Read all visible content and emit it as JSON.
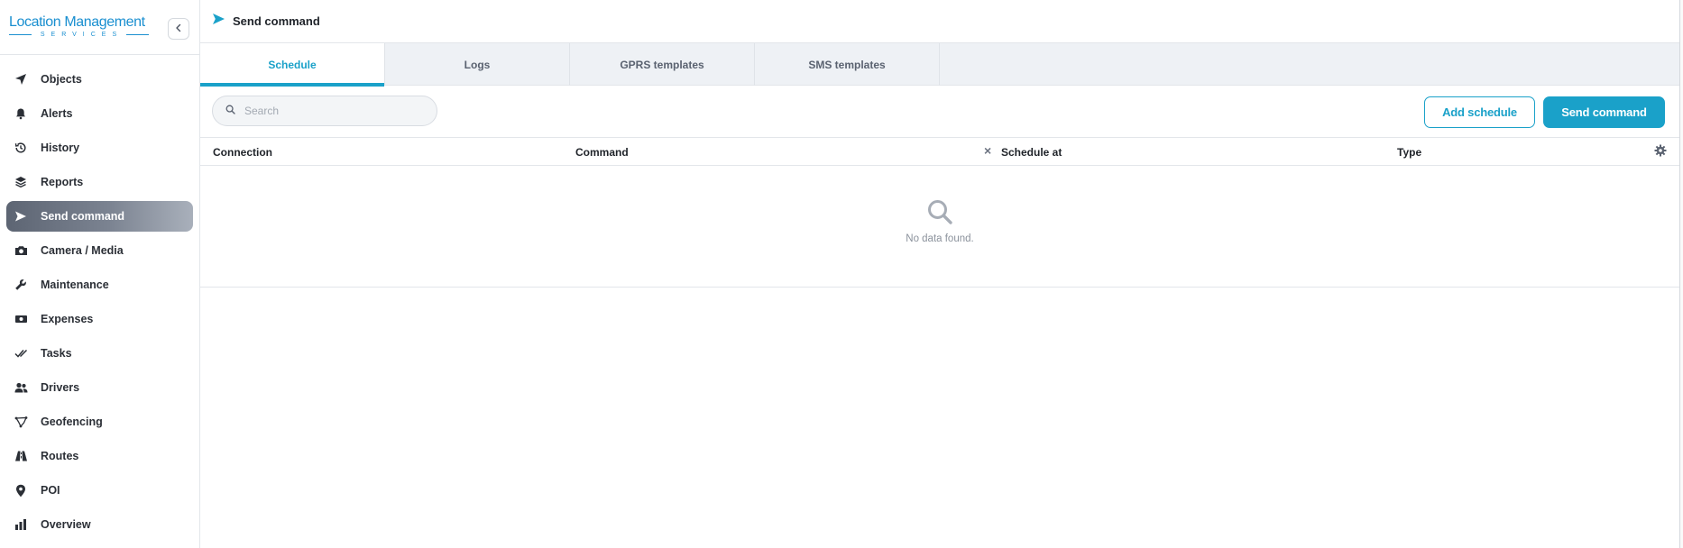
{
  "brand": {
    "title": "Location Management",
    "subtitle": "SERVICES"
  },
  "sidebar": {
    "items": [
      {
        "label": "Objects",
        "icon": "navigation-arrow-icon"
      },
      {
        "label": "Alerts",
        "icon": "bell-icon"
      },
      {
        "label": "History",
        "icon": "history-icon"
      },
      {
        "label": "Reports",
        "icon": "layers-icon"
      },
      {
        "label": "Send command",
        "icon": "send-icon",
        "active": true
      },
      {
        "label": "Camera / Media",
        "icon": "camera-icon"
      },
      {
        "label": "Maintenance",
        "icon": "wrench-icon"
      },
      {
        "label": "Expenses",
        "icon": "money-icon"
      },
      {
        "label": "Tasks",
        "icon": "double-check-icon"
      },
      {
        "label": "Drivers",
        "icon": "users-icon"
      },
      {
        "label": "Geofencing",
        "icon": "polygon-icon"
      },
      {
        "label": "Routes",
        "icon": "road-icon"
      },
      {
        "label": "POI",
        "icon": "map-pin-icon"
      },
      {
        "label": "Overview",
        "icon": "bar-chart-icon"
      }
    ]
  },
  "header": {
    "title": "Send command"
  },
  "tabs": [
    {
      "label": "Schedule",
      "active": true
    },
    {
      "label": "Logs"
    },
    {
      "label": "GPRS templates"
    },
    {
      "label": "SMS templates"
    }
  ],
  "toolbar": {
    "search_placeholder": "Search",
    "add_schedule_label": "Add schedule",
    "send_command_label": "Send command"
  },
  "table": {
    "columns": [
      "Connection",
      "Command",
      "Schedule at",
      "Type"
    ],
    "empty_message": "No data found."
  },
  "colors": {
    "accent": "#1aa1c9",
    "brand": "#1a8fd0",
    "active_nav": "#6b7380"
  }
}
